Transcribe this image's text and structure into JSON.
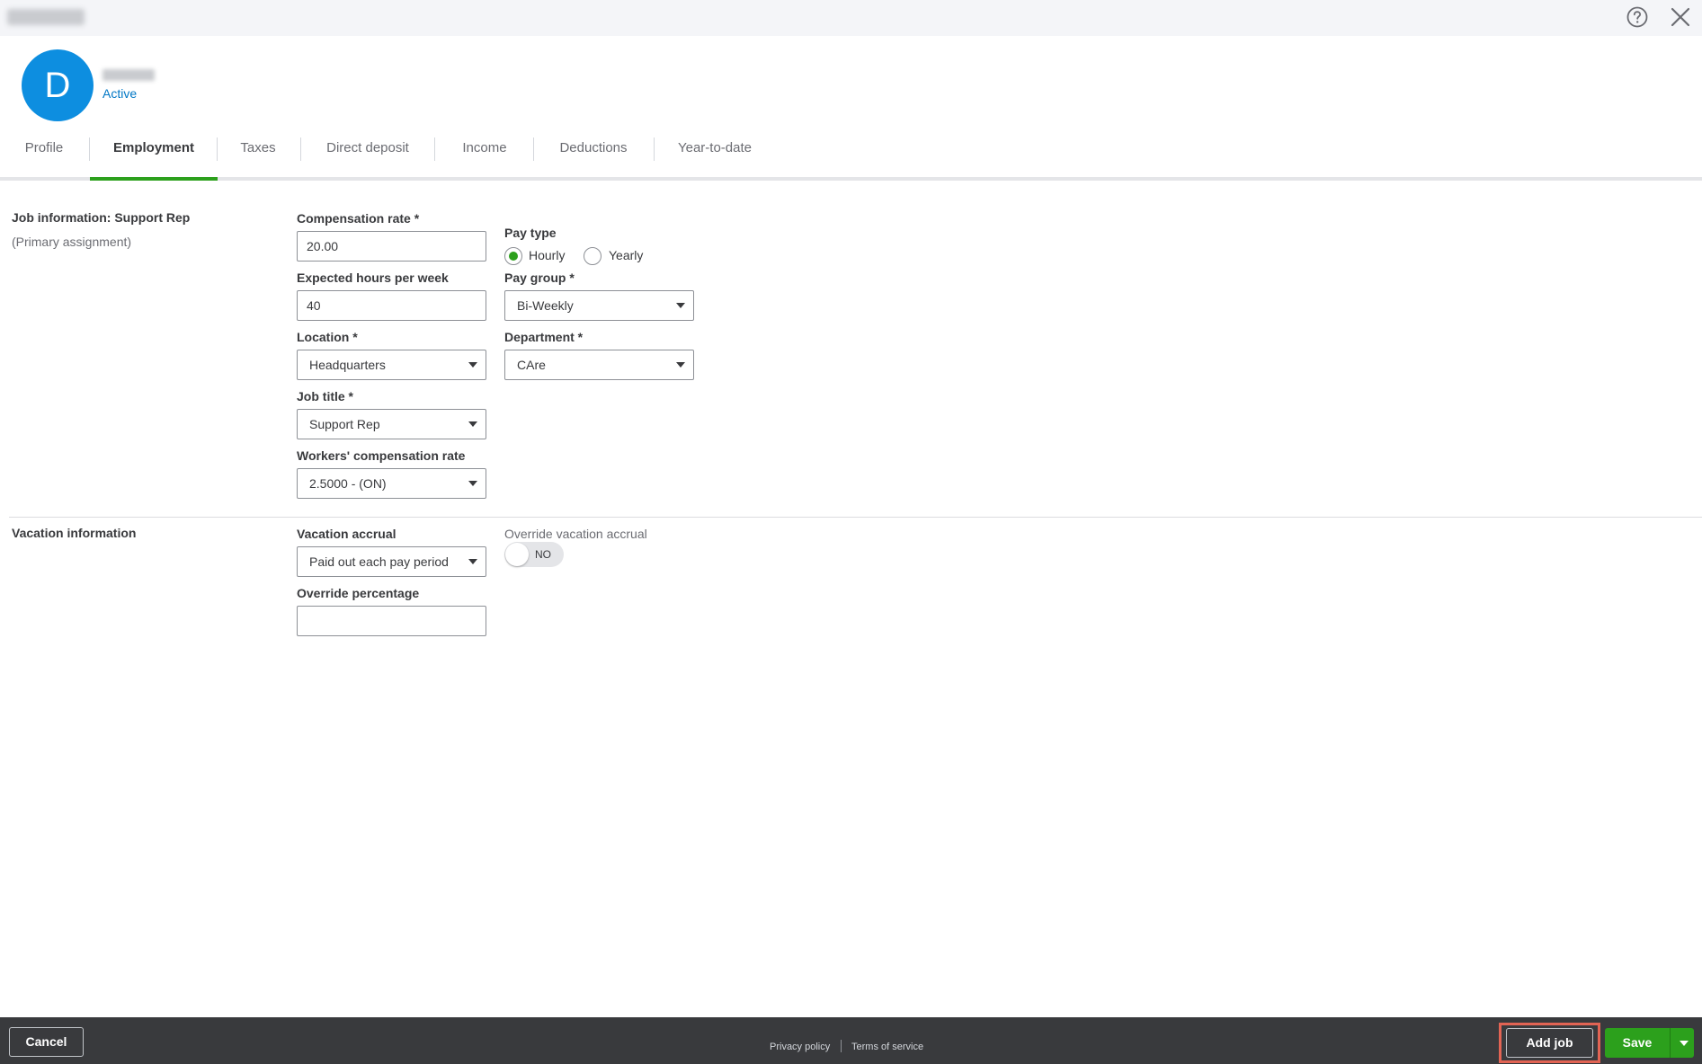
{
  "header": {
    "help_icon": "help-circle-icon",
    "close_icon": "close-icon"
  },
  "employee": {
    "avatar_initial": "D",
    "status": "Active"
  },
  "tabs": [
    {
      "label": "Profile"
    },
    {
      "label": "Employment"
    },
    {
      "label": "Taxes"
    },
    {
      "label": "Direct deposit"
    },
    {
      "label": "Income"
    },
    {
      "label": "Deductions"
    },
    {
      "label": "Year-to-date"
    }
  ],
  "active_tab": "Employment",
  "job_info": {
    "title": "Job information: Support Rep",
    "subtitle": "(Primary assignment)",
    "compensation_rate": {
      "label": "Compensation rate *",
      "value": "20.00"
    },
    "pay_type": {
      "label": "Pay type",
      "options": [
        "Hourly",
        "Yearly"
      ],
      "selected": "Hourly"
    },
    "expected_hours": {
      "label": "Expected hours per week",
      "value": "40"
    },
    "pay_group": {
      "label": "Pay group *",
      "value": "Bi-Weekly"
    },
    "location": {
      "label": "Location *",
      "value": "Headquarters"
    },
    "department": {
      "label": "Department *",
      "value": "CAre"
    },
    "job_title": {
      "label": "Job title *",
      "value": "Support Rep"
    },
    "workers_comp": {
      "label": "Workers' compensation rate",
      "value": "2.5000 - (ON)"
    }
  },
  "vacation": {
    "title": "Vacation information",
    "accrual": {
      "label": "Vacation accrual",
      "value": "Paid out each pay period"
    },
    "override_accrual": {
      "label": "Override vacation accrual",
      "toggle": "NO"
    },
    "override_percentage": {
      "label": "Override percentage",
      "value": ""
    }
  },
  "footer": {
    "cancel": "Cancel",
    "privacy": "Privacy policy",
    "terms": "Terms of service",
    "add_job": "Add job",
    "save": "Save"
  },
  "colors": {
    "accent_green": "#2ca01c",
    "link_blue": "#0077c5",
    "avatar_blue": "#0d8ee0",
    "footer_bg": "#393a3d",
    "highlight_red": "#e26454"
  }
}
